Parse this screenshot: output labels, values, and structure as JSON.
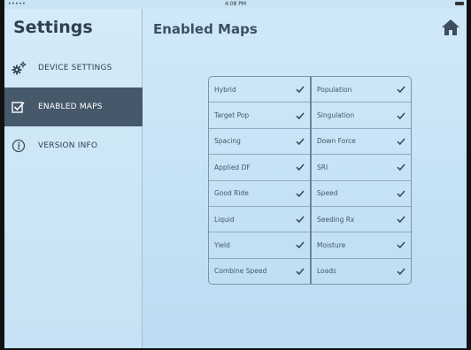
{
  "status_bar": {
    "signal": "•••••",
    "time": "4:08 PM"
  },
  "sidebar": {
    "title": "Settings",
    "items": [
      {
        "label": "DEVICE SETTINGS",
        "icon": "gears-icon",
        "active": false
      },
      {
        "label": "ENABLED MAPS",
        "icon": "checkbox-icon",
        "active": true
      },
      {
        "label": "VERSION INFO",
        "icon": "info-icon",
        "active": false
      }
    ]
  },
  "main": {
    "title": "Enabled Maps",
    "home_icon": "home-icon"
  },
  "maps": {
    "left": [
      {
        "name": "Hybrid",
        "enabled": true
      },
      {
        "name": "Target Pop",
        "enabled": true
      },
      {
        "name": "Spacing",
        "enabled": true
      },
      {
        "name": "Applied DF",
        "enabled": true
      },
      {
        "name": "Good Ride",
        "enabled": true
      },
      {
        "name": "Liquid",
        "enabled": true
      },
      {
        "name": "Yield",
        "enabled": true
      },
      {
        "name": "Combine Speed",
        "enabled": true
      }
    ],
    "right": [
      {
        "name": "Population",
        "enabled": true
      },
      {
        "name": "Singulation",
        "enabled": true
      },
      {
        "name": "Down Force",
        "enabled": true
      },
      {
        "name": "SRI",
        "enabled": true
      },
      {
        "name": "Speed",
        "enabled": true
      },
      {
        "name": "Seeding Rx",
        "enabled": true
      },
      {
        "name": "Moisture",
        "enabled": true
      },
      {
        "name": "Loads",
        "enabled": true
      }
    ]
  },
  "colors": {
    "sidebar_active": "#46596b",
    "background": "#c8e4f5",
    "check": "#3a4c5e"
  }
}
